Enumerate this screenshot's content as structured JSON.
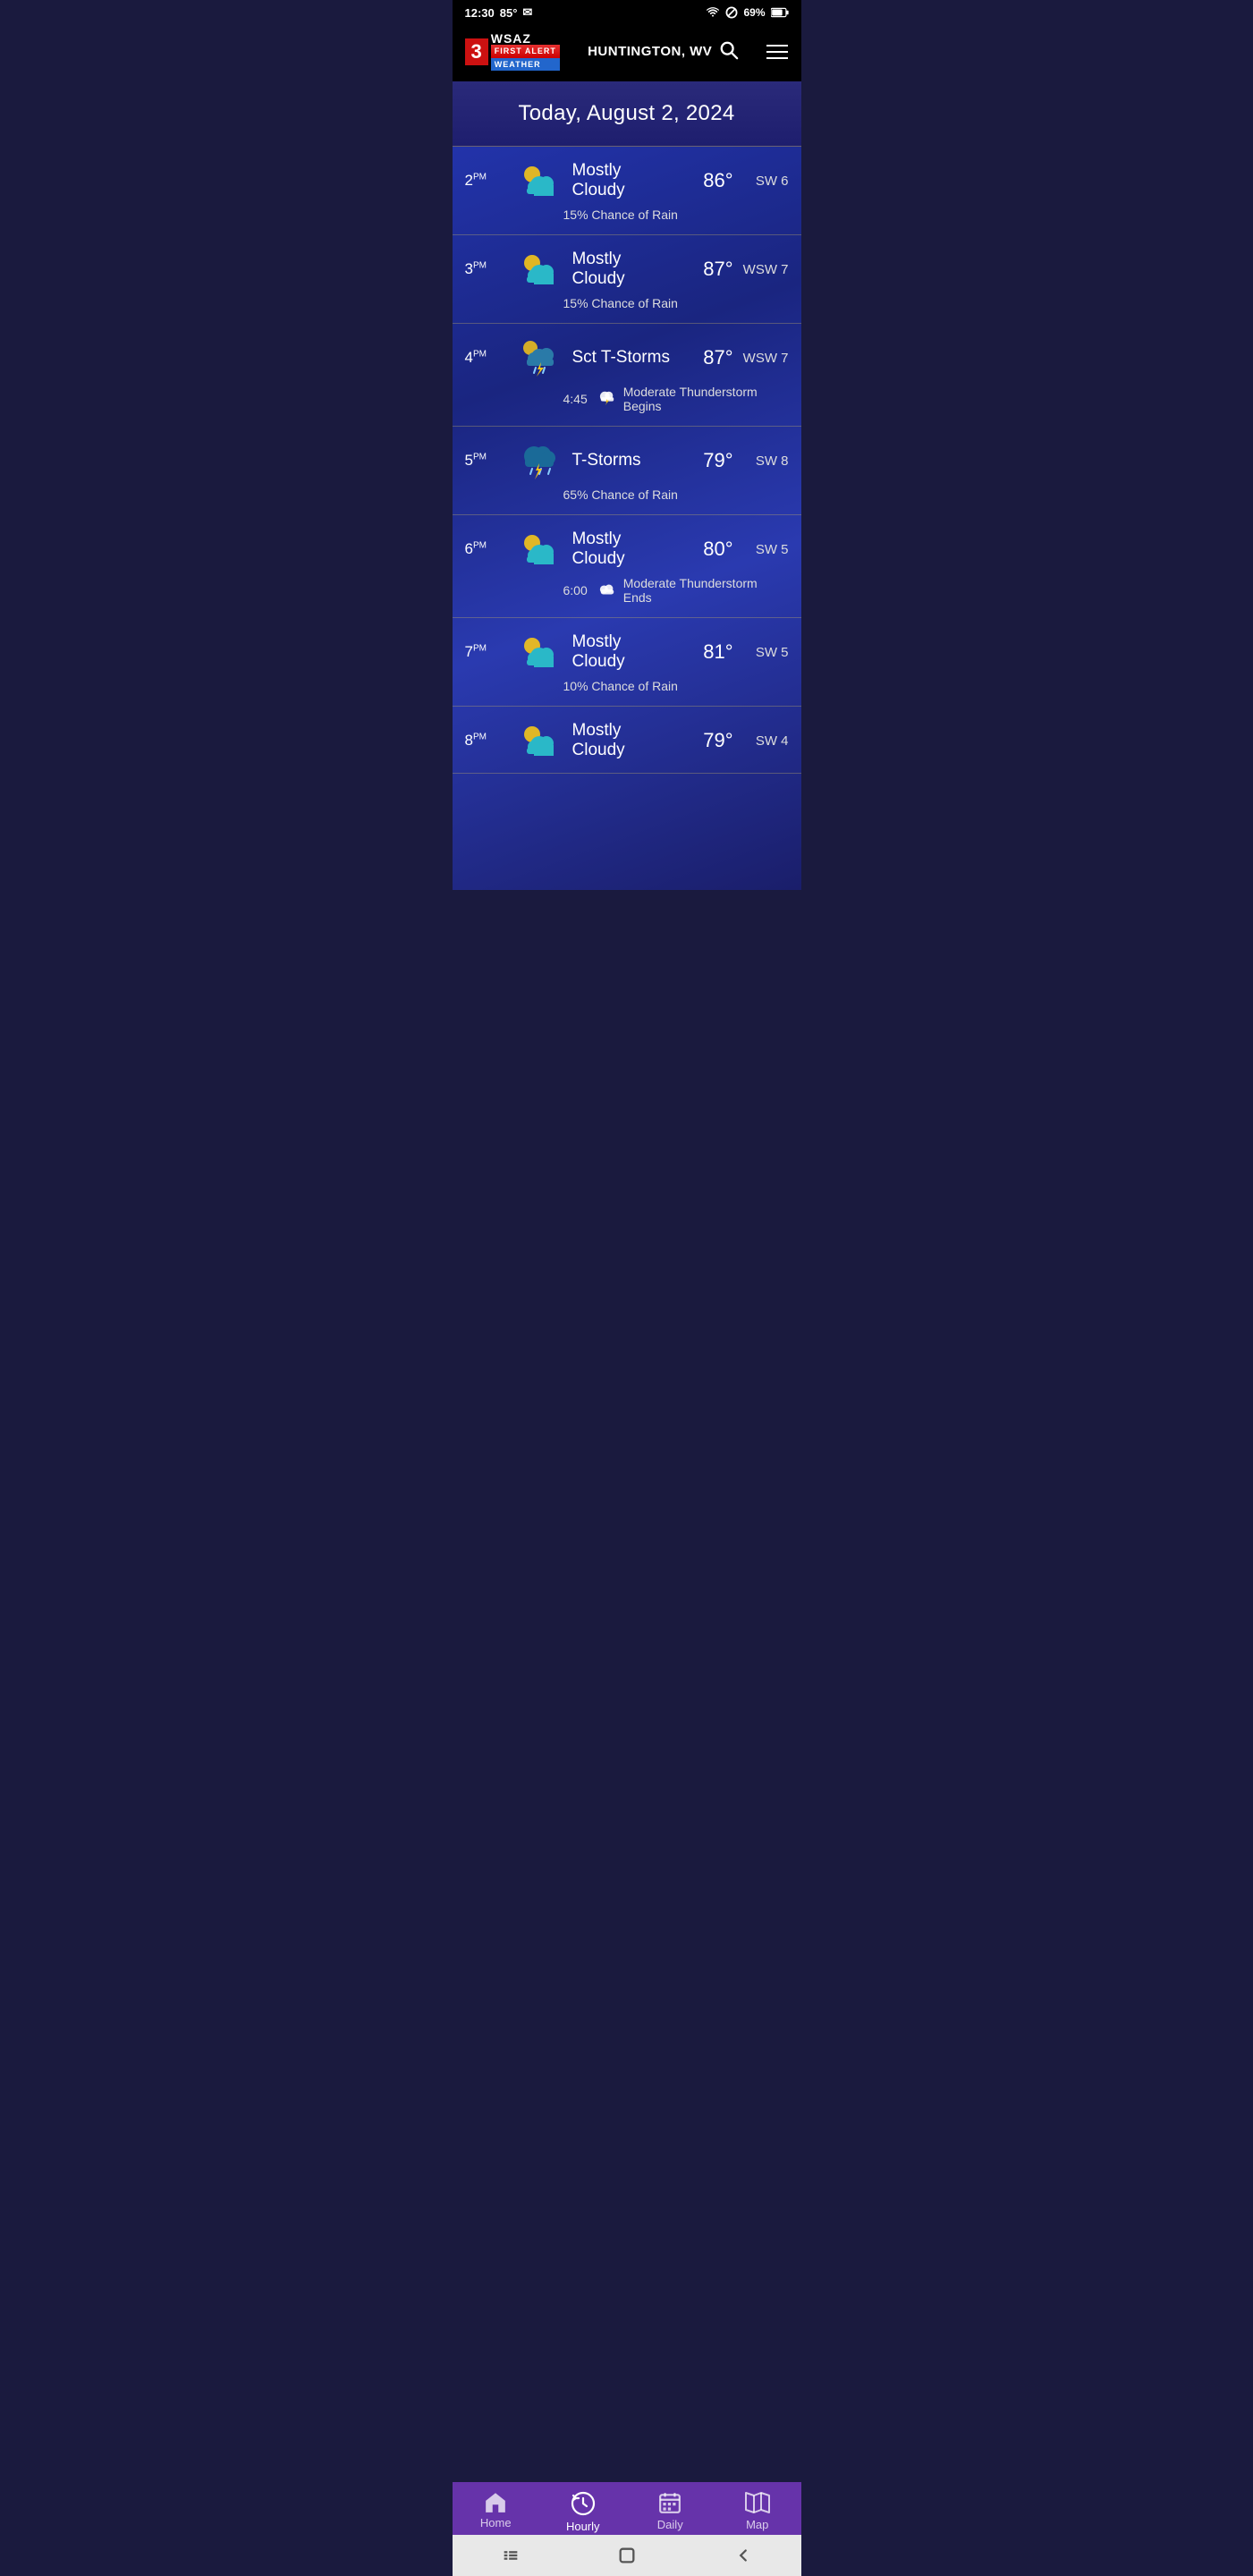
{
  "statusBar": {
    "time": "12:30",
    "temp": "85°",
    "battery": "69%"
  },
  "header": {
    "logoNum": "3",
    "logoWsaz": "WSAZ",
    "firstAlert": "FIRST ALERT",
    "weather": "WEATHER",
    "location": "HUNTINGTON, WV",
    "searchAriaLabel": "Search location",
    "menuAriaLabel": "Menu"
  },
  "dateBanner": {
    "text": "Today, August 2, 2024"
  },
  "hourlyRows": [
    {
      "time": "2",
      "timeSuffix": "PM",
      "icon": "mostly-cloudy-day",
      "description": "Mostly Cloudy",
      "temp": "86°",
      "wind": "SW 6",
      "subText": "15% Chance of Rain",
      "subTime": "",
      "subIcon": ""
    },
    {
      "time": "3",
      "timeSuffix": "PM",
      "icon": "mostly-cloudy-day",
      "description": "Mostly Cloudy",
      "temp": "87°",
      "wind": "WSW 7",
      "subText": "15% Chance of Rain",
      "subTime": "",
      "subIcon": ""
    },
    {
      "time": "4",
      "timeSuffix": "PM",
      "icon": "sct-tstorms",
      "description": "Sct T-Storms",
      "temp": "87°",
      "wind": "WSW 7",
      "subText": "Moderate Thunderstorm Begins",
      "subTime": "4:45",
      "subIcon": "cloud-lightning"
    },
    {
      "time": "5",
      "timeSuffix": "PM",
      "icon": "tstorms",
      "description": "T-Storms",
      "temp": "79°",
      "wind": "SW 8",
      "subText": "65% Chance of Rain",
      "subTime": "",
      "subIcon": ""
    },
    {
      "time": "6",
      "timeSuffix": "PM",
      "icon": "mostly-cloudy-day",
      "description": "Mostly Cloudy",
      "temp": "80°",
      "wind": "SW 5",
      "subText": "Moderate Thunderstorm Ends",
      "subTime": "6:00",
      "subIcon": "cloud"
    },
    {
      "time": "7",
      "timeSuffix": "PM",
      "icon": "mostly-cloudy-day",
      "description": "Mostly Cloudy",
      "temp": "81°",
      "wind": "SW 5",
      "subText": "10% Chance of Rain",
      "subTime": "",
      "subIcon": ""
    },
    {
      "time": "8",
      "timeSuffix": "PM",
      "icon": "mostly-cloudy-day",
      "description": "Mostly Cloudy",
      "temp": "79°",
      "wind": "SW 4",
      "subText": "",
      "subTime": "",
      "subIcon": ""
    }
  ],
  "bottomNav": {
    "items": [
      {
        "id": "home",
        "label": "Home",
        "icon": "home"
      },
      {
        "id": "hourly",
        "label": "Hourly",
        "icon": "back-clock",
        "active": true
      },
      {
        "id": "daily",
        "label": "Daily",
        "icon": "calendar"
      },
      {
        "id": "map",
        "label": "Map",
        "icon": "map"
      }
    ]
  }
}
